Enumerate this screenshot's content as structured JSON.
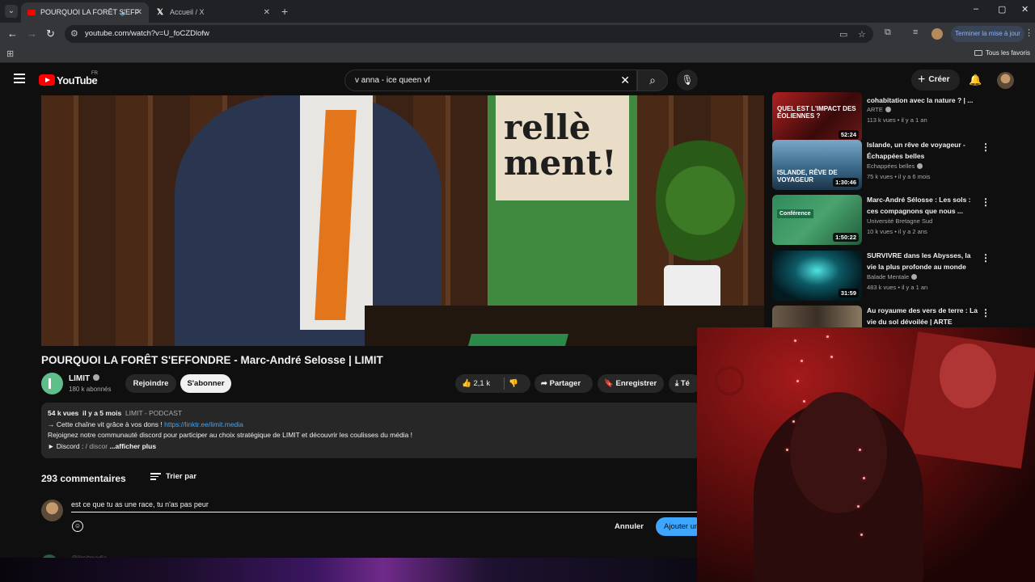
{
  "browser": {
    "tabs": [
      {
        "title": "POURQUOI LA FORÊT S'EFF",
        "active": true
      },
      {
        "title": "Accueil / X",
        "active": false
      }
    ],
    "url": "youtube.com/watch?v=U_foCZDlofw",
    "update_label": "Terminer la mise à jour",
    "bookmarks_all": "Tous les favoris"
  },
  "youtube": {
    "logo_text": "YouTube",
    "logo_country": "FR",
    "search_query": "v anna - ice queen vf",
    "create_label": "Créer"
  },
  "video": {
    "banner_text": "rellè ment!",
    "title": "POURQUOI LA FORÊT S'EFFONDRE - Marc-André Selosse | LIMIT",
    "channel": "LIMIT",
    "subscribers": "180 k abonnés",
    "join_label": "Rejoindre",
    "subscribe_label": "S'abonner",
    "likes": "2,1 k",
    "share_label": "Partager",
    "save_label": "Enregistrer",
    "download_label": "Té"
  },
  "description": {
    "views": "54 k vues",
    "age": "il y a 5 mois",
    "tags": "LIMIT - PODCAST",
    "line1_prefix": "→ Cette chaîne vit grâce à vos dons ! ",
    "line1_link": "https://linktr.ee/limit.media",
    "line2": "Rejoignez notre communauté discord pour participer au choix stratégique de LIMIT et découvrir les coulisses du média !",
    "line3_prefix": "► Discord : ",
    "line3_link": "/ discor",
    "more": "...afficher plus"
  },
  "comments": {
    "count": "293 commentaires",
    "sort_label": "Trier par",
    "draft": "est ce que tu as une race, tu n'as pas peur",
    "cancel_label": "Annuler",
    "submit_label": "Ajouter un commentaire",
    "next_author": "@limitmedia"
  },
  "recommendations": [
    {
      "title": "cohabitation avec la nature ? | ...",
      "channel": "ARTE",
      "verified": true,
      "views": "113 k vues",
      "age": "il y a 1 an",
      "duration": "52:24",
      "thumb_caption": "QUEL EST L'IMPACT DES ÉOLIENNES ?"
    },
    {
      "title": "Islande, un rêve de voyageur - Échappées belles",
      "channel": "Echappées belles",
      "verified": true,
      "views": "75 k vues",
      "age": "il y a 6 mois",
      "duration": "1:30:46",
      "thumb_caption": "ISLANDE, RÊVE DE VOYAGEUR"
    },
    {
      "title": "Marc-André Sélosse : Les sols : ces compagnons que nous ...",
      "channel": "Université Bretagne Sud",
      "verified": false,
      "views": "10 k vues",
      "age": "il y a 2 ans",
      "duration": "1:50:22",
      "thumb_caption": "Conférence"
    },
    {
      "title": "SURVIVRE dans les Abysses, la vie la plus profonde au monde",
      "channel": "Balade Mentale",
      "verified": true,
      "views": "483 k vues",
      "age": "il y a 1 an",
      "duration": "31:59",
      "thumb_caption": ""
    },
    {
      "title": "Au royaume des vers de terre : La vie du sol dévoilée | ARTE",
      "channel": "",
      "verified": false,
      "views": "",
      "age": "",
      "duration": "",
      "thumb_caption": ""
    }
  ],
  "colors": {
    "background": "#0f0f0f",
    "accent_blue": "#3ea6ff",
    "youtube_red": "#ff0000",
    "chip": "#272727"
  },
  "icons": [
    "tab-search-icon",
    "mute-icon",
    "close-icon",
    "back-icon",
    "forward-icon",
    "reload-icon",
    "site-info-icon",
    "cast-icon",
    "star-icon",
    "extensions-icon",
    "menu-icon",
    "search-icon",
    "mic-icon",
    "bell-icon",
    "like-icon",
    "dislike-icon",
    "share-icon",
    "bookmark-icon",
    "download-icon",
    "sort-icon",
    "emoji-icon",
    "kebab-icon"
  ]
}
